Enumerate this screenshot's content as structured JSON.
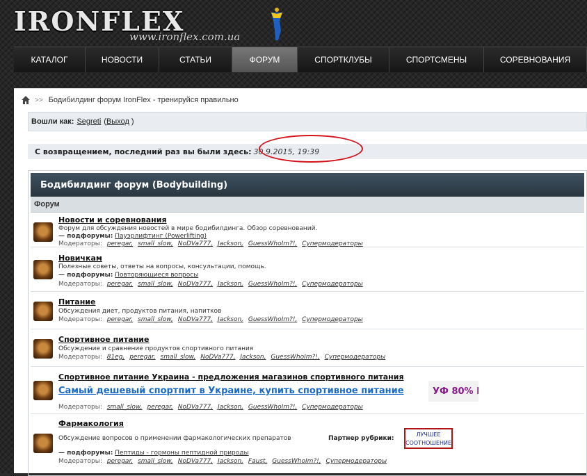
{
  "logo": {
    "text": "IRONFLEX",
    "url": "www.ironflex.com.ua"
  },
  "nav": [
    {
      "label": "КАТАЛОГ",
      "active": false
    },
    {
      "label": "НОВОСТИ",
      "active": false
    },
    {
      "label": "СТАТЬИ",
      "active": false
    },
    {
      "label": "ФОРУМ",
      "active": true
    },
    {
      "label": "СПОРТКЛУБЫ",
      "active": false
    },
    {
      "label": "СПОРТСМЕНЫ",
      "active": false
    },
    {
      "label": "СОРЕВНОВАНИЯ",
      "active": false
    }
  ],
  "breadcrumb": {
    "separator": ">>",
    "text": "Бодибилдинг форум IronFlex - тренируйся правильно"
  },
  "login": {
    "prefix": "Вошли как:",
    "user": "Segreti",
    "open_paren": "(",
    "logout": "Выход",
    "close_paren": ")"
  },
  "welcome": {
    "text": "С возвращением, последний раз вы были здесь:",
    "date": "30.9.2015, 19:39"
  },
  "forum": {
    "title": "Бодибилдинг форум (Bodybuilding)",
    "column": "Форум",
    "moderators_label": "Модераторы:",
    "subforums_label": "— подфорумы:",
    "rows": [
      {
        "title": "Новости и соревнования",
        "desc": "Форум для обсуждения новостей в мире бодибилдинга. Обзор соревнований.",
        "subforum": "Пауэрлифтинг (Powerlifting)",
        "mods": [
          "peregar,",
          "small_slow,",
          "NoDVa777,",
          "Jackson,",
          "GuessWhoIm?!,",
          "Супермодераторы"
        ]
      },
      {
        "title": "Новичкам",
        "desc": "Полезные советы, ответы на вопросы, консультации, помощь.",
        "subforum": "Повторяющиеся вопросы",
        "mods": [
          "peregar,",
          "small_slow,",
          "NoDVa777,",
          "Jackson,",
          "GuessWhoIm?!,",
          "Супермодераторы"
        ]
      },
      {
        "title": "Питание",
        "desc": "Обсуждения диет, продуктов питания, напитков",
        "mods": [
          "peregar,",
          "small_slow,",
          "NoDVa777,",
          "Jackson,",
          "GuessWhoIm?!,",
          "Супермодераторы"
        ]
      },
      {
        "title": "Спортивное питание",
        "desc": "Обсуждение и сравнение продуктов спортивного питания",
        "mods": [
          "81eg,",
          "peregar,",
          "small_slow,",
          "NoDVa777,",
          "Jackson,",
          "GuessWhoIm?!,",
          "Супермодераторы"
        ]
      },
      {
        "title": "Спортивное питание Украина - предложения магазинов спортивного питания",
        "promo": "Самый дешевый спортпит в Украине, купить спортивное питание",
        "badge": "УФ 80% I",
        "mods": [
          "small_slow,",
          "peregar,",
          "NoDVa777,",
          "Jackson,",
          "GuessWhoIm?!,",
          "Супермодераторы"
        ]
      },
      {
        "title": "Фармакология",
        "desc": "Обсуждение вопросов о применении фармакологических препаратов",
        "partner_label": "Партнер рубрики:",
        "partner_text": "ЛУЧШЕЕ СООТНОШЕНИЕ",
        "subforum": "Пептиды - гормоны пептидной природы",
        "mods": [
          "peregar,",
          "small_slow,",
          "NoDVa777,",
          "Jackson,",
          "Faust,",
          "GuessWhoIm?!,",
          "Супермодераторы"
        ]
      }
    ]
  },
  "colors": {
    "nav_active": "#666666",
    "forum_header": "#2f3e49",
    "promo_link": "#1a6ac8",
    "highlight_circle": "#d4121a"
  }
}
